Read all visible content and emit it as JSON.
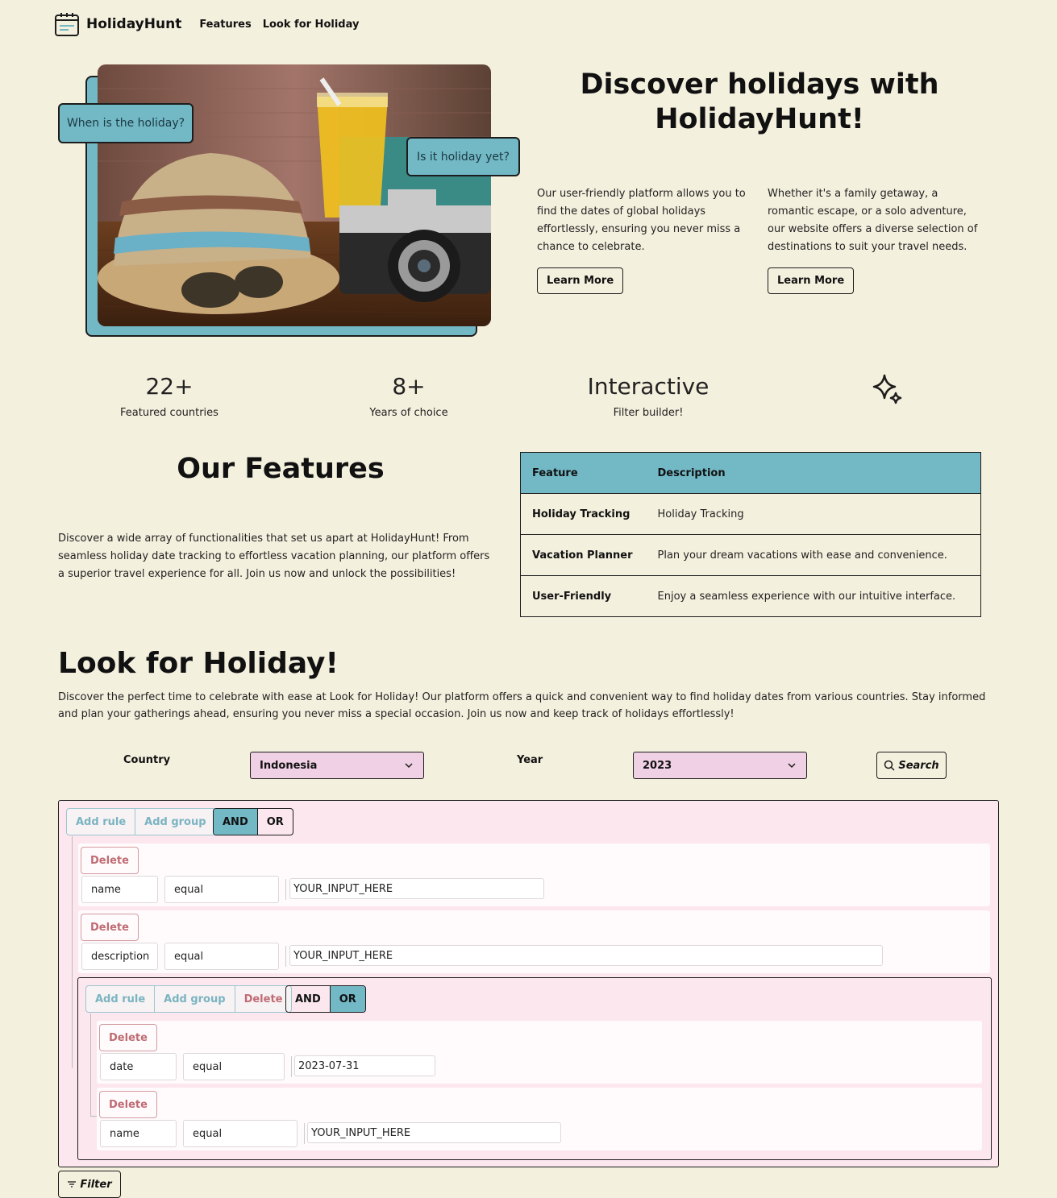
{
  "nav": {
    "brand": "HolidayHunt",
    "links": [
      "Features",
      "Look for Holiday"
    ]
  },
  "hero": {
    "bubble_left": "When is the holiday?",
    "bubble_right": "Is it holiday yet?",
    "title": "Discover holidays with HolidayHunt!",
    "col1_text": "Our user-friendly platform allows you to find the dates of global holidays effortlessly, ensuring you never miss a chance to celebrate.",
    "col2_text": "Whether it's a family getaway, a romantic escape, or a solo adventure, our website offers a diverse selection of destinations to suit your travel needs.",
    "learn_more": "Learn More"
  },
  "stats": [
    {
      "value": "22+",
      "label": "Featured countries"
    },
    {
      "value": "8+",
      "label": "Years of choice"
    },
    {
      "value": "Interactive",
      "label": "Filter builder!"
    }
  ],
  "features": {
    "title": "Our Features",
    "text": "Discover a wide array of functionalities that set us apart at HolidayHunt! From seamless holiday date tracking to effortless vacation planning, our platform offers a superior travel experience for all. Join us now and unlock the possibilities!",
    "table_headers": [
      "Feature",
      "Description"
    ],
    "rows": [
      {
        "feature": "Holiday Tracking",
        "description": "Holiday Tracking"
      },
      {
        "feature": "Vacation Planner",
        "description": "Plan your dream vacations with ease and convenience."
      },
      {
        "feature": "User-Friendly",
        "description": "Enjoy a seamless experience with our intuitive interface."
      }
    ]
  },
  "look": {
    "title": "Look for Holiday!",
    "text": "Discover the perfect time to celebrate with ease at Look for Holiday! Our platform offers a quick and convenient way to find holiday dates from various countries. Stay informed and plan your gatherings ahead, ensuring you never miss a special occasion. Join us now and keep track of holidays effortlessly!",
    "country_label": "Country",
    "country_value": "Indonesia",
    "year_label": "Year",
    "year_value": "2023",
    "search_label": "Search"
  },
  "query_builder": {
    "add_rule": "Add rule",
    "add_group": "Add group",
    "delete": "Delete",
    "and": "AND",
    "or": "OR",
    "root_combinator": "AND",
    "rules": [
      {
        "field": "name",
        "operator": "equal",
        "value": "YOUR_INPUT_HERE"
      },
      {
        "field": "description",
        "operator": "equal",
        "value": "YOUR_INPUT_HERE"
      }
    ],
    "subgroup": {
      "combinator": "OR",
      "rules": [
        {
          "field": "date",
          "operator": "equal",
          "value": "2023-07-31"
        },
        {
          "field": "name",
          "operator": "equal",
          "value": "YOUR_INPUT_HERE"
        }
      ]
    },
    "filter_label": "Filter"
  },
  "colors": {
    "background": "#f4f0de",
    "accent_teal": "#72b8c5",
    "select_pink": "#efd0e4",
    "builder_pink": "#fce7ef",
    "delete_red": "#c06b73"
  }
}
